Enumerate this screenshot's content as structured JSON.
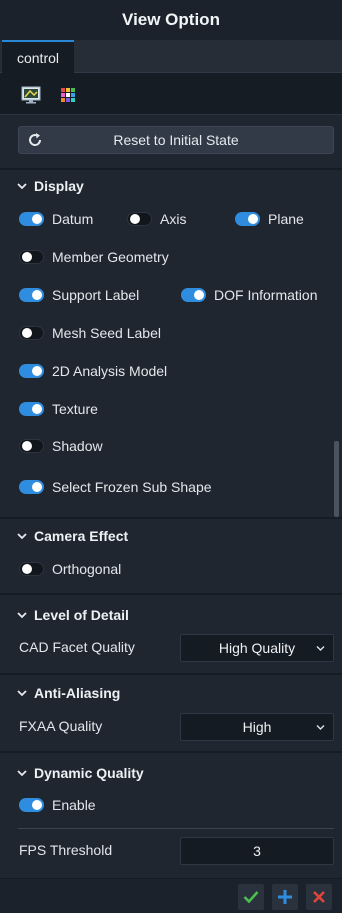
{
  "window": {
    "title": "View Option"
  },
  "tabs": [
    {
      "label": "control"
    }
  ],
  "toolbar": {
    "reset_label": "Reset to Initial State"
  },
  "sections": {
    "display": {
      "title": "Display",
      "toggles": {
        "datum": {
          "label": "Datum",
          "on": true
        },
        "axis": {
          "label": "Axis",
          "on": false
        },
        "plane": {
          "label": "Plane",
          "on": true
        },
        "member_geometry": {
          "label": "Member Geometry",
          "on": false
        },
        "support_label": {
          "label": "Support Label",
          "on": true
        },
        "dof_information": {
          "label": "DOF Information",
          "on": true
        },
        "mesh_seed_label": {
          "label": "Mesh Seed Label",
          "on": false
        },
        "analysis_model_2d": {
          "label": "2D Analysis Model",
          "on": true
        },
        "texture": {
          "label": "Texture",
          "on": true
        },
        "shadow": {
          "label": "Shadow",
          "on": false
        },
        "select_frozen": {
          "label": "Select Frozen Sub Shape",
          "on": true
        }
      }
    },
    "camera_effect": {
      "title": "Camera Effect",
      "orthogonal": {
        "label": "Orthogonal",
        "on": false
      }
    },
    "level_of_detail": {
      "title": "Level of Detail",
      "cad_facet_label": "CAD Facet Quality",
      "cad_facet_value": "High Quality"
    },
    "anti_aliasing": {
      "title": "Anti-Aliasing",
      "fxaa_label": "FXAA Quality",
      "fxaa_value": "High"
    },
    "dynamic_quality": {
      "title": "Dynamic Quality",
      "enable": {
        "label": "Enable",
        "on": true
      },
      "fps_label": "FPS Threshold",
      "fps_value": "3"
    }
  },
  "colors": {
    "accent": "#2f8de0",
    "confirm": "#4cc04c",
    "add": "#2f8de0",
    "close": "#e0453c"
  }
}
